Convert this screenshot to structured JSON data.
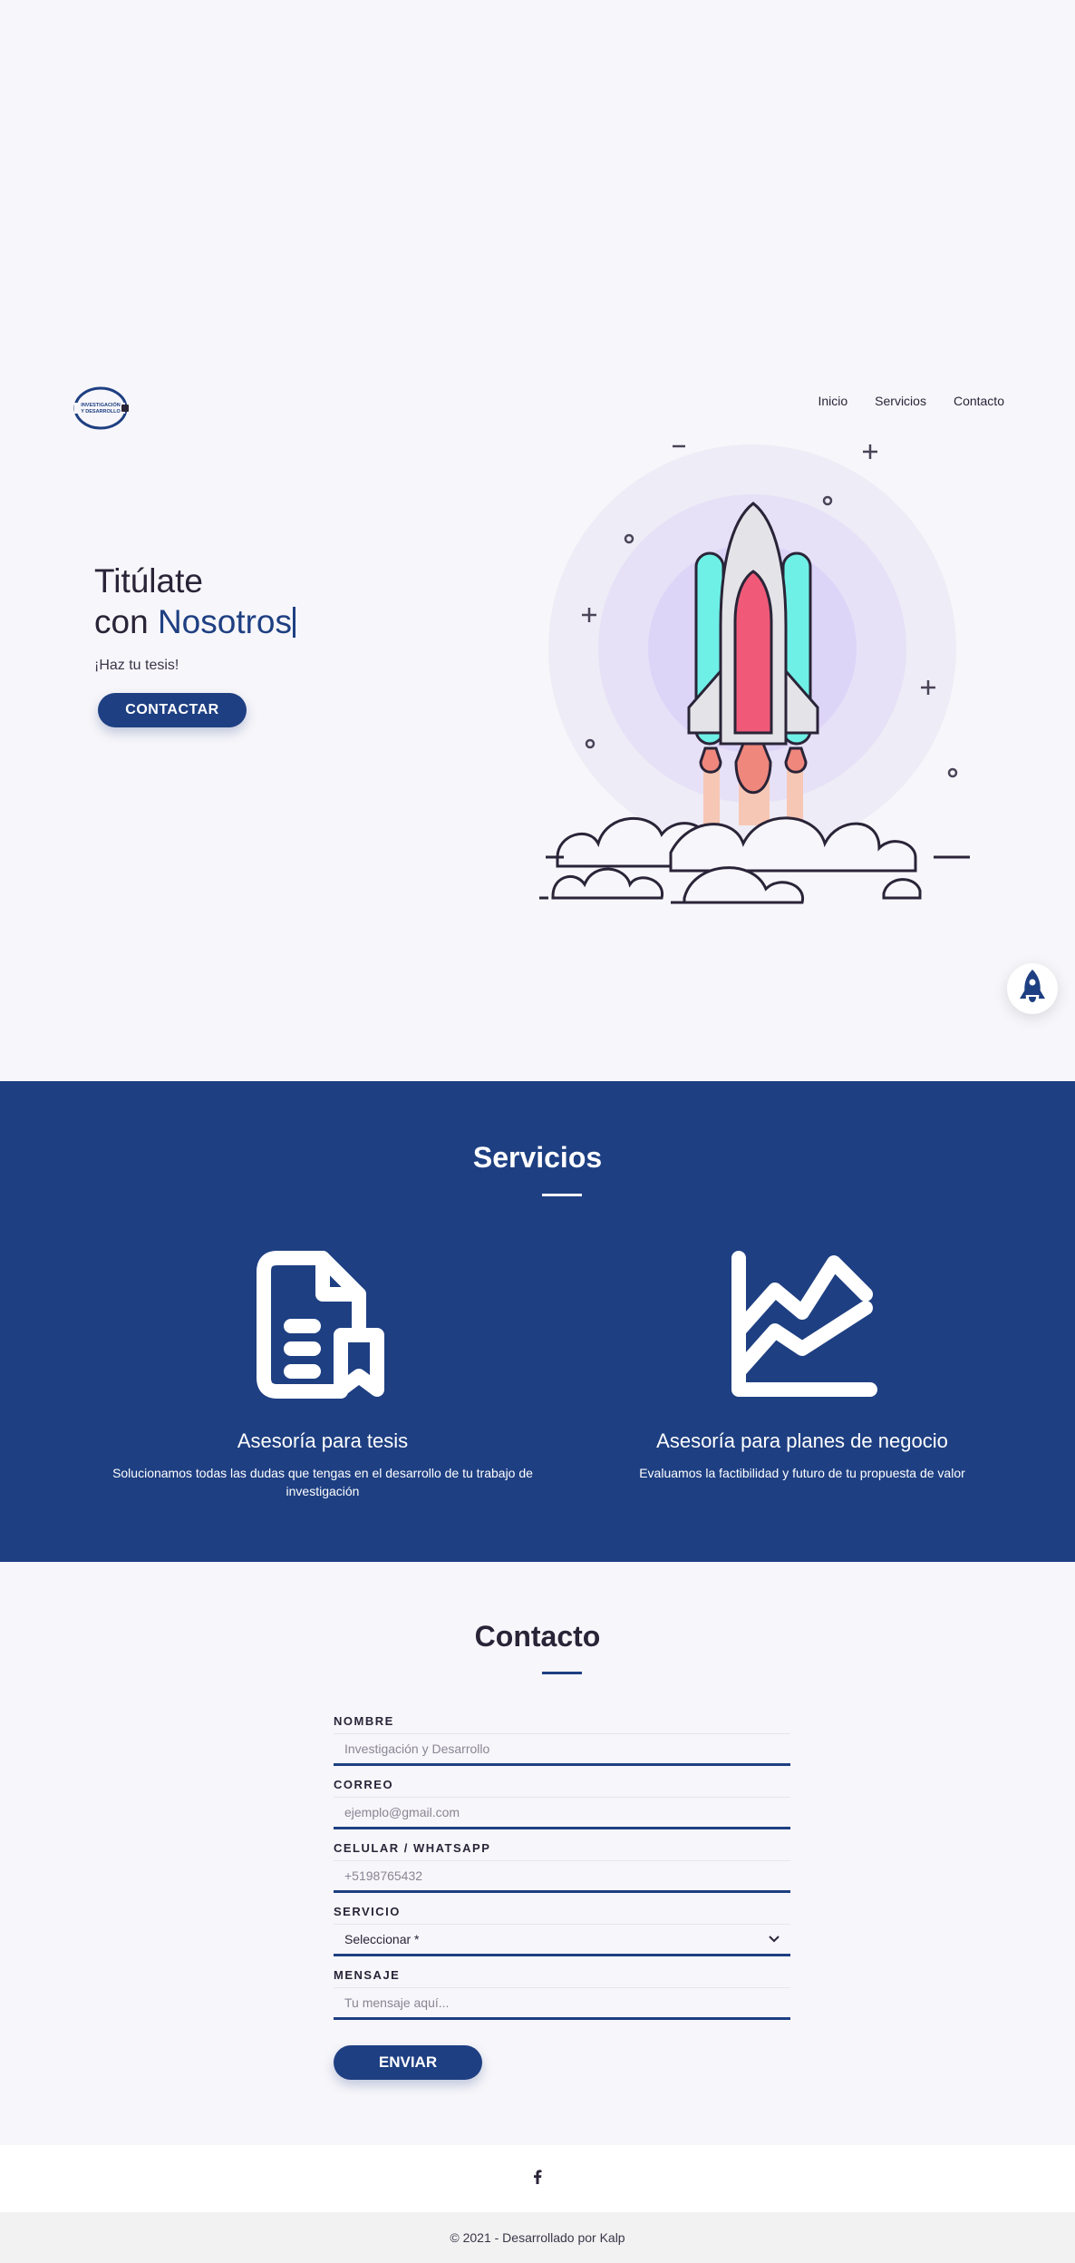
{
  "header": {
    "logo_text": "INVESTIGACIÓN Y DESARROLLO",
    "nav": [
      "Inicio",
      "Servicios",
      "Contacto"
    ]
  },
  "hero": {
    "title_line1": "Titúlate",
    "title_line2_prefix": "con ",
    "title_line2_accent": "Nosotros",
    "subtitle": "¡Haz tu tesis!",
    "cta_label": "CONTACTAR"
  },
  "services": {
    "title": "Servicios",
    "items": [
      {
        "icon": "document-bookmark-icon",
        "title": "Asesoría para tesis",
        "desc": "Solucionamos todas las dudas que tengas en el desarrollo de tu trabajo de investigación"
      },
      {
        "icon": "growth-chart-icon",
        "title": "Asesoría para planes de negocio",
        "desc": "Evaluamos la factibilidad y futuro de tu propuesta de valor"
      }
    ]
  },
  "contact": {
    "title": "Contacto",
    "fields": [
      {
        "label": "NOMBRE",
        "placeholder": "Investigación y Desarrollo"
      },
      {
        "label": "CORREO",
        "placeholder": "ejemplo@gmail.com"
      },
      {
        "label": "CELULAR / WHATSAPP",
        "placeholder": "+5198765432"
      },
      {
        "label": "SERVICIO",
        "value": "Seleccionar *"
      },
      {
        "label": "MENSAJE",
        "placeholder": "Tu mensaje aquí..."
      }
    ],
    "submit_label": "ENVIAR"
  },
  "footer": {
    "social_icon": "facebook-icon",
    "copyright": "© 2021 - Desarrollado por Kalp"
  },
  "colors": {
    "brand": "#1e3f82",
    "background": "#f7f6fa"
  }
}
